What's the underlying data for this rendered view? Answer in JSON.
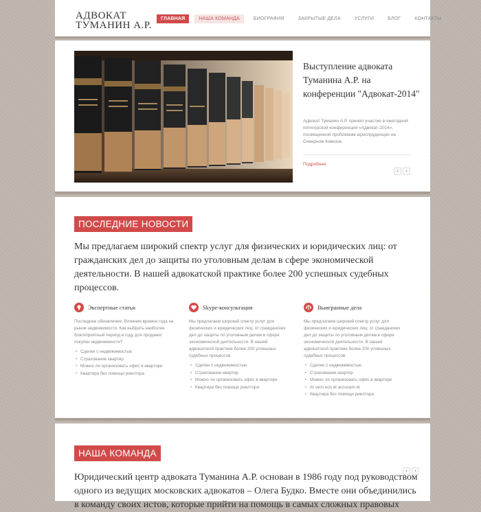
{
  "header": {
    "logo_line1": "АДВОКАТ",
    "logo_line2": "ТУМАНИН А.Р.",
    "nav": [
      {
        "label": "Главная"
      },
      {
        "label": "Наша команда"
      },
      {
        "label": "Биография"
      },
      {
        "label": "Закрытые дела"
      },
      {
        "label": "Услуги"
      },
      {
        "label": "Блог"
      },
      {
        "label": "Контакты"
      }
    ]
  },
  "slider": {
    "title": "Выступление адвоката Туманина А.Р. на конференции \"Адвокат-2014\"",
    "text": "Адвокат Туманин А.Р. принял участие в ежегодной пятигорской конференции «Адвокат-2014», посвященной проблемам юриспруденции на Северном Кавказе.",
    "more": "Подробнее",
    "prev": "‹",
    "next": "›"
  },
  "news": {
    "title": "ПОСЛЕДНИЕ НОВОСТИ",
    "lead": "Мы предлагаем широкий спектр услуг для физических и юридических лиц: от гражданских дел до защиты по уголовным делам в сфере экономической деятельности. В нашей адвокатской практике более 200 успешных судебных процессов.",
    "columns": [
      {
        "icon": "lightbulb-icon",
        "title": "Экспертные статьи",
        "text": "Последнее обновление: Влияние времен года на рынок недвижимости. Как выбрать наиболее благоприятный период в году для продажи/покупки недвижимости?",
        "items": [
          "Сделки с недвижимостью",
          "Страхование квартир",
          "Можно ли организовать офис в квартире",
          "Квартира без помощи риелтора"
        ]
      },
      {
        "icon": "heart-icon",
        "title": "Skype-консультация",
        "text": "Мы предлагаем широкий спектр услуг для физических и юридических лиц: от гражданских дел до защиты по уголовным делам в сфере экономической деятельности. В нашей адвокатской практике более 200 успешных судебных процессов.",
        "items": [
          "Сделки с недвижимостью",
          "Страхование квартир",
          "Можно ли организовать офис в квартире",
          "Квартира без помощи риелтора"
        ]
      },
      {
        "icon": "scales-icon",
        "title": "Выигранные дела",
        "text": "Мы предлагаем широкий спектр услуг для физических и юридических лиц: от гражданских дел до защиты по уголовным делам в сфере экономической деятельности. В нашей адвокатской практике более 200 успешных судебных процессов.",
        "items": [
          "Сделки с недвижимостью",
          "Страхование квартир",
          "Можно ли организовать офис в квартире",
          "At vero eos et accusam et",
          "Квартира без помощи риелтора"
        ]
      }
    ]
  },
  "team": {
    "title": "НАША КОМАНДА",
    "lead": "Юридический центр адвоката Туманина А.Р. основан в 1986 году под руководством одного из ведущих московских адвокатов – Олега Будко. Вместе они объединились в команду своих истов, которые прийти на помощь в самых сложных правовых",
    "prev": "‹",
    "next": "›"
  },
  "colors": {
    "accent": "#d14a4a",
    "background": "#bfb7ae",
    "divider": "#a89e95"
  }
}
